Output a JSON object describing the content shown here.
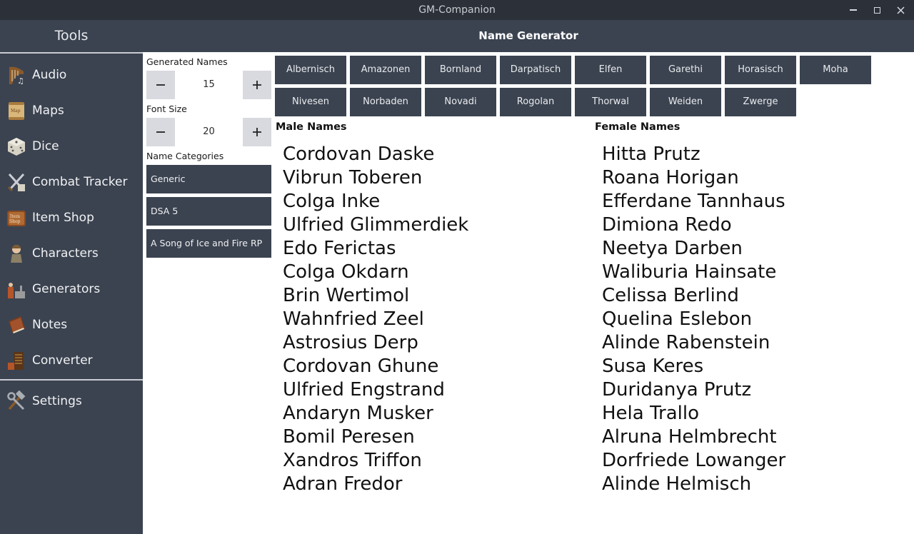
{
  "window": {
    "title": "GM-Companion"
  },
  "header": {
    "tools_title": "Tools",
    "page_title": "Name Generator"
  },
  "sidebar": {
    "items": [
      {
        "label": "Audio",
        "icon": "harp-icon"
      },
      {
        "label": "Maps",
        "icon": "map-scroll-icon"
      },
      {
        "label": "Dice",
        "icon": "dice-icon"
      },
      {
        "label": "Combat Tracker",
        "icon": "crossed-swords-icon"
      },
      {
        "label": "Item Shop",
        "icon": "item-shop-sign-icon"
      },
      {
        "label": "Characters",
        "icon": "character-icon"
      },
      {
        "label": "Generators",
        "icon": "generators-icon"
      },
      {
        "label": "Notes",
        "icon": "notebook-icon"
      },
      {
        "label": "Converter",
        "icon": "converter-icon"
      }
    ],
    "settings": {
      "label": "Settings",
      "icon": "hammer-wrench-icon"
    }
  },
  "controls": {
    "generated_names_label": "Generated Names",
    "generated_names_value": "15",
    "font_size_label": "Font Size",
    "font_size_value": "20",
    "name_categories_label": "Name Categories",
    "categories": [
      "Generic",
      "DSA 5",
      "A Song of Ice and Fire RP"
    ]
  },
  "regions": {
    "row1": [
      "Albernisch",
      "Amazonen",
      "Bornland",
      "Darpatisch",
      "Elfen",
      "Garethi",
      "Horasisch",
      "Moha"
    ],
    "row2": [
      "Nivesen",
      "Norbaden",
      "Novadi",
      "Rogolan",
      "Thorwal",
      "Weiden",
      "Zwerge"
    ]
  },
  "names": {
    "male_label": "Male Names",
    "female_label": "Female Names",
    "male": [
      "Cordovan Daske",
      "Vibrun Toberen",
      "Colga Inke",
      "Ulfried Glimmerdiek",
      "Edo Ferictas",
      "Colga Okdarn",
      "Brin Wertimol",
      "Wahnfried Zeel",
      "Astrosius Derp",
      "Cordovan Ghune",
      "Ulfried Engstrand",
      "Andaryn Musker",
      "Bomil Peresen",
      "Xandros Triffon",
      "Adran Fredor"
    ],
    "female": [
      "Hitta Prutz",
      "Roana Horigan",
      "Efferdane Tannhaus",
      "Dimiona Redo",
      "Neetya Darben",
      "Waliburia Hainsate",
      "Celissa Berlind",
      "Quelina Eslebon",
      "Alinde Rabenstein",
      "Susa Keres",
      "Duridanya Prutz",
      "Hela Trallo",
      "Alruna Helmbrecht",
      "Dorfriede Lowanger",
      "Alinde Helmisch"
    ]
  }
}
